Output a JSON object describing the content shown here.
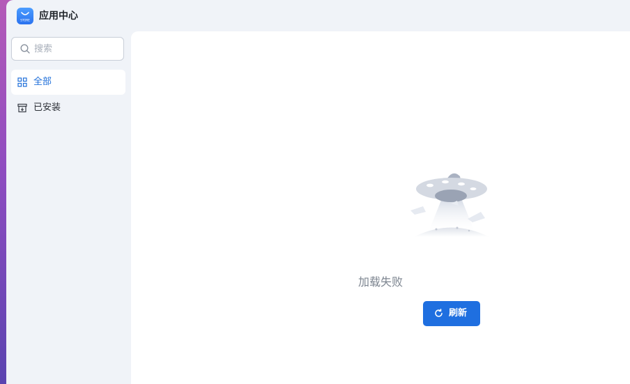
{
  "app": {
    "title": "应用中心",
    "icon": "app-store-icon",
    "icon_text": "STORE",
    "accent_color": "#1f6fe0"
  },
  "sidebar": {
    "search": {
      "placeholder": "搜索",
      "icon": "search-icon"
    },
    "items": [
      {
        "label": "全部",
        "icon": "grid-icon",
        "active": true
      },
      {
        "label": "已安装",
        "icon": "installed-box-icon",
        "active": false
      }
    ]
  },
  "main": {
    "illustration": "ufo-illustration",
    "error_text": "加载失败",
    "refresh_button": {
      "label": "刷新",
      "icon": "refresh-icon"
    }
  }
}
